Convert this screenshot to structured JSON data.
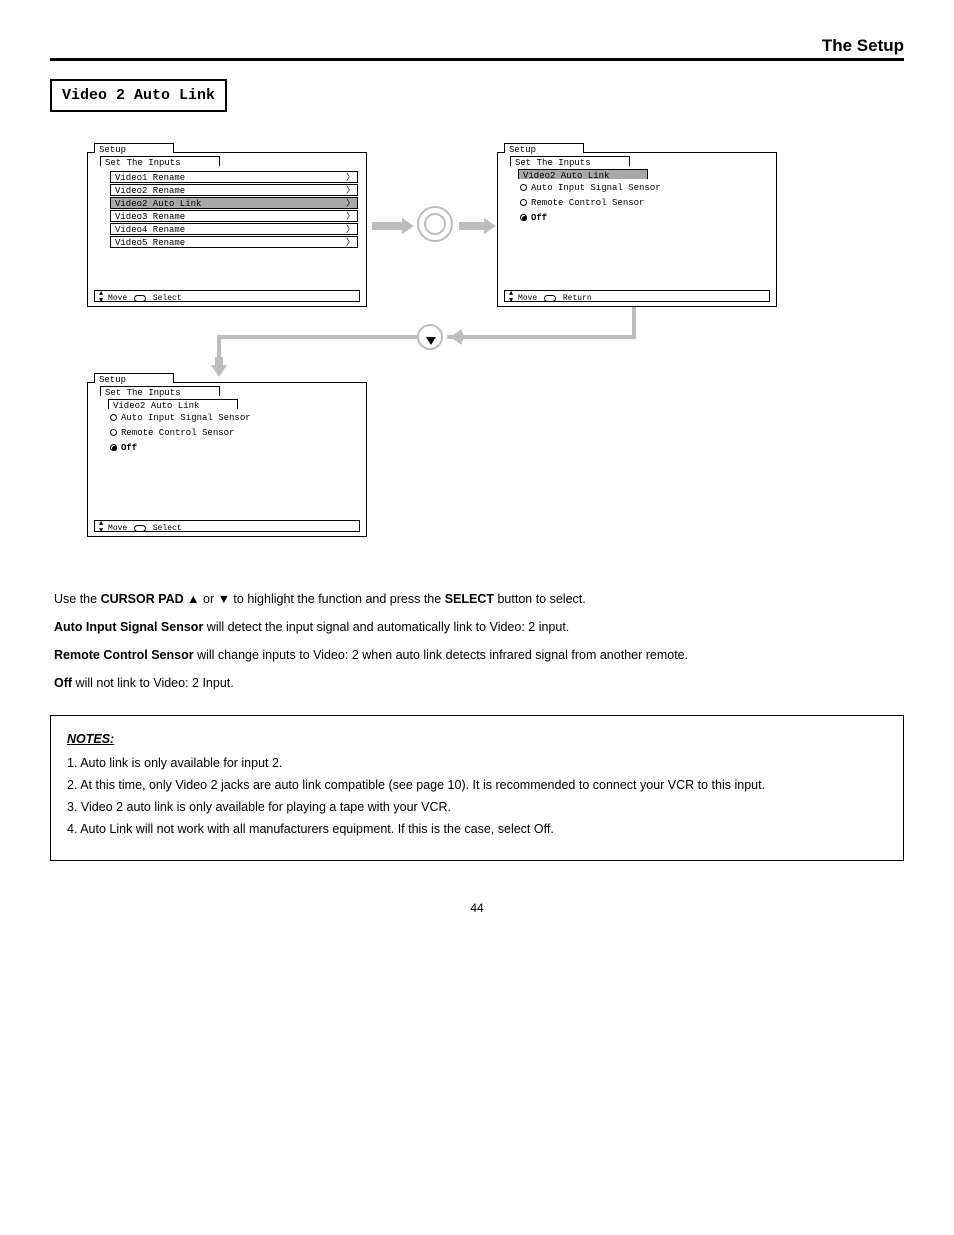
{
  "header_right": "The Setup",
  "section_heading": "Video 2 Auto Link",
  "panel1": {
    "tab1": "Setup",
    "tab2": "Set The Inputs",
    "items": [
      {
        "label": "Video1 Rename",
        "sel": false
      },
      {
        "label": "Video2 Rename",
        "sel": false
      },
      {
        "label": "Video2 Auto Link",
        "sel": true
      },
      {
        "label": "Video3 Rename",
        "sel": false
      },
      {
        "label": "Video4 Rename",
        "sel": false
      },
      {
        "label": "Video5 Rename",
        "sel": false
      }
    ],
    "footer_move": "Move",
    "footer_action": "Select"
  },
  "panel2": {
    "tab1": "Setup",
    "tab2": "Set The Inputs",
    "tab3": "Video2 Auto Link",
    "opts": [
      {
        "label": "Auto Input Signal Sensor",
        "sel": false
      },
      {
        "label": "Remote Control Sensor",
        "sel": false
      },
      {
        "label": "Off",
        "sel": true
      }
    ],
    "footer_move": "Move",
    "footer_action": "Return"
  },
  "panel3": {
    "tab1": "Setup",
    "tab2": "Set The Inputs",
    "tab3": "Video2 Auto Link",
    "opts": [
      {
        "label": "Auto Input Signal Sensor",
        "sel": false
      },
      {
        "label": "Remote Control Sensor",
        "sel": false
      },
      {
        "label": "Off",
        "sel": true
      }
    ],
    "footer_move": "Move",
    "footer_action": "Select"
  },
  "body": {
    "p1_a": "Use the ",
    "p1_b": "CURSOR PAD ▲",
    "p1_c": " or ",
    "p1_d": "▼",
    "p1_e": " to highlight the function and press the ",
    "p1_f": "SELECT",
    "p1_g": " button to select.",
    "opt1_label": "Auto Input Signal Sensor",
    "opt1_desc": " will detect the input signal and automatically link to Video: 2 input.",
    "opt2_label": "Remote Control Sensor",
    "opt2_desc": " will change inputs to Video: 2 when auto link detects infrared signal from another remote.",
    "opt3_label": "Off",
    "opt3_desc": " will not link to Video: 2 Input."
  },
  "notes": {
    "hdr": "NOTES:",
    "n1": "1. Auto link is only available for input 2.",
    "n2": "2. At this time, only Video 2 jacks are auto link compatible (see page 10). It is recommended to connect your VCR to this input.",
    "n3": "3. Video 2 auto link is only available for playing a tape with your VCR.",
    "n4": "4. Auto Link will not work with all manufacturers equipment. If this is the case, select Off."
  },
  "page_number": "44"
}
